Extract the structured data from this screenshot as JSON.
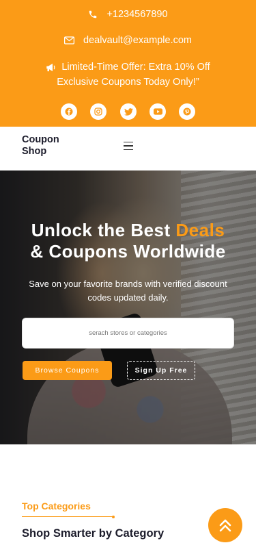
{
  "topbar": {
    "phone": "+1234567890",
    "email": "dealvault@example.com",
    "offer": "Limited-Time Offer: Extra 10% Off Exclusive Coupons Today Only!”",
    "social": [
      "facebook-icon",
      "instagram-icon",
      "twitter-icon",
      "youtube-icon",
      "pinterest-icon"
    ]
  },
  "nav": {
    "brand": "Coupon Shop"
  },
  "hero": {
    "title_part1": "Unlock the Best ",
    "title_accent": "Deals",
    "title_part2": "& Coupons Worldwide",
    "subtitle": "Save on your favorite brands with verified discount codes updated daily.",
    "search_placeholder": "serach stores or categories",
    "browse_label": "Browse Coupons",
    "signup_label": "Sign Up Free"
  },
  "categories": {
    "eyebrow": "Top Categories",
    "title": "Shop Smarter by Category"
  },
  "colors": {
    "accent": "#fb9b17",
    "dark": "#1c1c2b",
    "white": "#ffffff"
  }
}
